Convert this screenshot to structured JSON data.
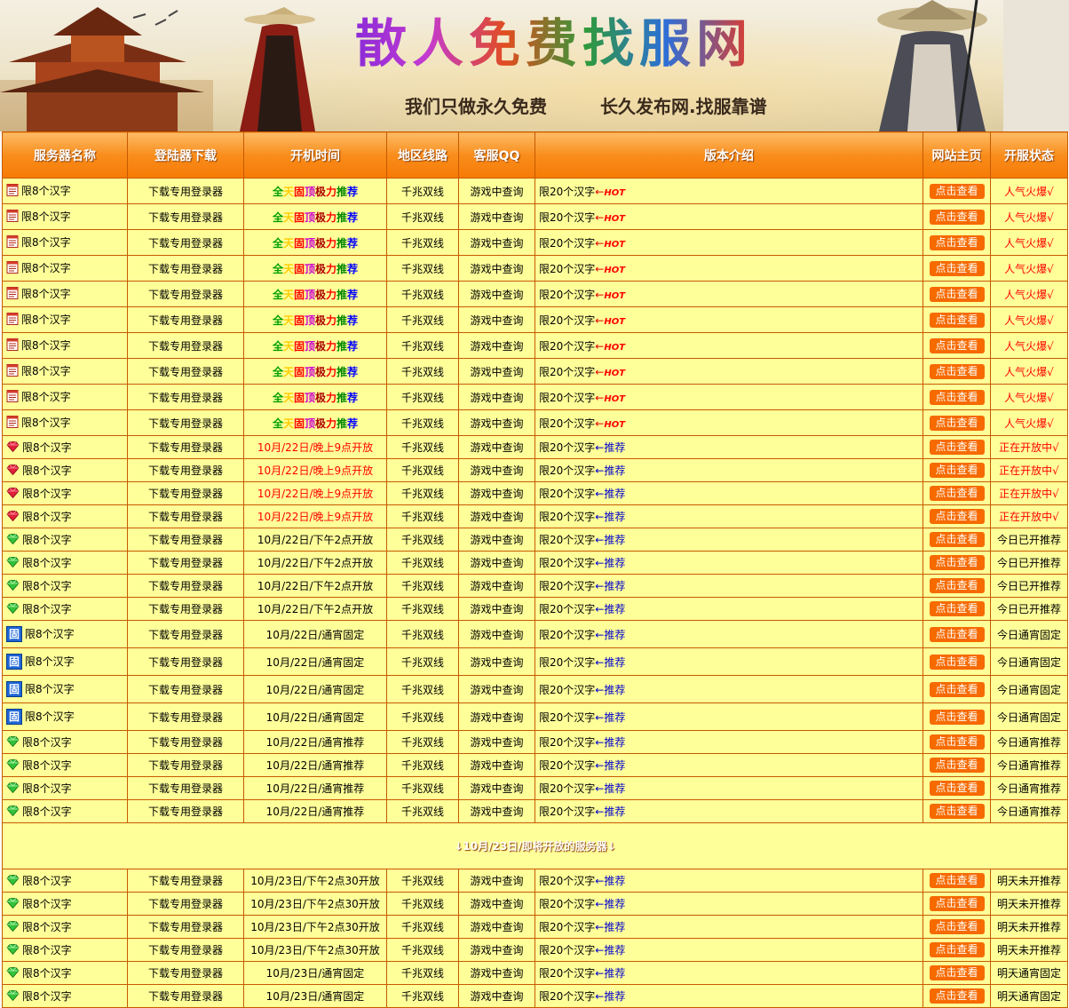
{
  "banner": {
    "title": "散人免费找服网",
    "slogan1": "我们只做永久免费",
    "slogan2": "长久发布网.找服靠谱"
  },
  "headers": [
    "服务器名称",
    "登陆器下载",
    "开机时间",
    "地区线路",
    "客服QQ",
    "版本介绍",
    "网站主页",
    "开服状态"
  ],
  "common": {
    "name": "限8个汉字",
    "download": "下载专用登录器",
    "region": "千兆双线",
    "qq": "游戏中查询",
    "intro": "限20个汉字",
    "hot": "HOT",
    "recommend": "推荐",
    "button": "点击查看"
  },
  "fixed_time_chars": [
    "全",
    "天",
    "固",
    "顶",
    "极",
    "力",
    "推",
    "荐"
  ],
  "rows_today": [
    {
      "icon": "doc-icon",
      "time": "全天固顶极力推荐",
      "intro": "限20个汉字",
      "tag": "HOT",
      "status": "人气火爆√"
    },
    {
      "icon": "doc-icon",
      "time": "全天固顶极力推荐",
      "intro": "限20个汉字",
      "tag": "HOT",
      "status": "人气火爆√"
    },
    {
      "icon": "doc-icon",
      "time": "全天固顶极力推荐",
      "intro": "限20个汉字",
      "tag": "HOT",
      "status": "人气火爆√"
    },
    {
      "icon": "doc-icon",
      "time": "全天固顶极力推荐",
      "intro": "限20个汉字",
      "tag": "HOT",
      "status": "人气火爆√"
    },
    {
      "icon": "doc-icon",
      "time": "全天固顶极力推荐",
      "intro": "限20个汉字",
      "tag": "HOT",
      "status": "人气火爆√"
    },
    {
      "icon": "doc-icon",
      "time": "全天固顶极力推荐",
      "intro": "限20个汉字",
      "tag": "HOT",
      "status": "人气火爆√"
    },
    {
      "icon": "doc-icon",
      "time": "全天固顶极力推荐",
      "intro": "限20个汉字",
      "tag": "HOT",
      "status": "人气火爆√"
    },
    {
      "icon": "doc-icon",
      "time": "全天固顶极力推荐",
      "intro": "限20个汉字",
      "tag": "HOT",
      "status": "人气火爆√"
    },
    {
      "icon": "doc-icon",
      "time": "全天固顶极力推荐",
      "intro": "限20个汉字",
      "tag": "HOT",
      "status": "人气火爆√"
    },
    {
      "icon": "doc-icon",
      "time": "全天固顶极力推荐",
      "intro": "限20个汉字",
      "tag": "HOT",
      "status": "人气火爆√"
    },
    {
      "icon": "red-gem-icon",
      "time": "10月/22日/晚上9点开放",
      "intro": "限20个汉字",
      "tag": "推荐",
      "status": "正在开放中√",
      "style": "hl"
    },
    {
      "icon": "red-gem-icon",
      "time": "10月/22日/晚上9点开放",
      "intro": "限20个汉字",
      "tag": "推荐",
      "status": "正在开放中√",
      "style": "hl"
    },
    {
      "icon": "red-gem-icon",
      "time": "10月/22日/晚上9点开放",
      "intro": "限20个汉字",
      "tag": "推荐",
      "status": "正在开放中√",
      "style": "hl"
    },
    {
      "icon": "red-gem-icon",
      "time": "10月/22日/晚上9点开放",
      "intro": "限20个汉字",
      "tag": "推荐",
      "status": "正在开放中√",
      "style": "hl"
    },
    {
      "icon": "green-gem-icon",
      "time": "10月/22日/下午2点开放",
      "intro": "限20个汉字",
      "tag": "推荐",
      "status": "今日已开推荐"
    },
    {
      "icon": "green-gem-icon",
      "time": "10月/22日/下午2点开放",
      "intro": "限20个汉字",
      "tag": "推荐",
      "status": "今日已开推荐",
      "style": "white"
    },
    {
      "icon": "green-gem-icon",
      "time": "10月/22日/下午2点开放",
      "intro": "限20个汉字",
      "tag": "推荐",
      "status": "今日已开推荐"
    },
    {
      "icon": "green-gem-icon",
      "time": "10月/22日/下午2点开放",
      "intro": "限20个汉字",
      "tag": "推荐",
      "status": "今日已开推荐"
    },
    {
      "icon": "fixed-badge-icon",
      "badge": "固",
      "time": "10月/22日/通宵固定",
      "intro": "限20个汉字",
      "tag": "推荐",
      "status": "今日通宵固定",
      "size": "r30"
    },
    {
      "icon": "fixed-badge-icon",
      "badge": "固",
      "time": "10月/22日/通宵固定",
      "intro": "限20个汉字",
      "tag": "推荐",
      "status": "今日通宵固定",
      "size": "r30"
    },
    {
      "icon": "fixed-badge-icon",
      "badge": "固",
      "time": "10月/22日/通宵固定",
      "intro": "限20个汉字",
      "tag": "推荐",
      "status": "今日通宵固定",
      "size": "r30"
    },
    {
      "icon": "fixed-badge-icon",
      "badge": "固",
      "time": "10月/22日/通宵固定",
      "intro": "限20个汉字",
      "tag": "推荐",
      "status": "今日通宵固定",
      "size": "r30"
    },
    {
      "icon": "green-gem-icon",
      "time": "10月/22日/通宵推荐",
      "intro": "限20个汉字",
      "tag": "推荐",
      "status": "今日通宵推荐"
    },
    {
      "icon": "green-gem-icon",
      "time": "10月/22日/通宵推荐",
      "intro": "限20个汉字",
      "tag": "推荐",
      "status": "今日通宵推荐"
    },
    {
      "icon": "green-gem-icon",
      "time": "10月/22日/通宵推荐",
      "intro": "限20个汉字",
      "tag": "推荐",
      "status": "今日通宵推荐"
    },
    {
      "icon": "green-gem-icon",
      "time": "10月/22日/通宵推荐",
      "intro": "限20个汉字",
      "tag": "推荐",
      "status": "今日通宵推荐"
    }
  ],
  "section_title": "↓10月/23日/即将开放的服务器↓",
  "rows_tomorrow": [
    {
      "icon": "green-gem-icon",
      "time": "10月/23日/下午2点30开放",
      "intro": "限20个汉字",
      "tag": "推荐",
      "status": "明天未开推荐"
    },
    {
      "icon": "green-gem-icon",
      "time": "10月/23日/下午2点30开放",
      "intro": "限20个汉字",
      "tag": "推荐",
      "status": "明天未开推荐"
    },
    {
      "icon": "green-gem-icon",
      "time": "10月/23日/下午2点30开放",
      "intro": "限20个汉字",
      "tag": "推荐",
      "status": "明天未开推荐"
    },
    {
      "icon": "green-gem-icon",
      "time": "10月/23日/下午2点30开放",
      "intro": "限20个汉字",
      "tag": "推荐",
      "status": "明天未开推荐"
    },
    {
      "icon": "green-gem-icon",
      "time": "10月/23日/通宵固定",
      "intro": "限20个汉字",
      "tag": "推荐",
      "status": "明天通宵固定"
    },
    {
      "icon": "green-gem-icon",
      "time": "10月/23日/通宵固定",
      "intro": "限20个汉字",
      "tag": "推荐",
      "status": "明天通宵固定"
    }
  ],
  "colors": {
    "header_orange": "#f98d1c",
    "row_yellow": "#ffff99",
    "row_highlight": "#ffff00",
    "button": "#f66a00",
    "border": "#c65a00"
  }
}
